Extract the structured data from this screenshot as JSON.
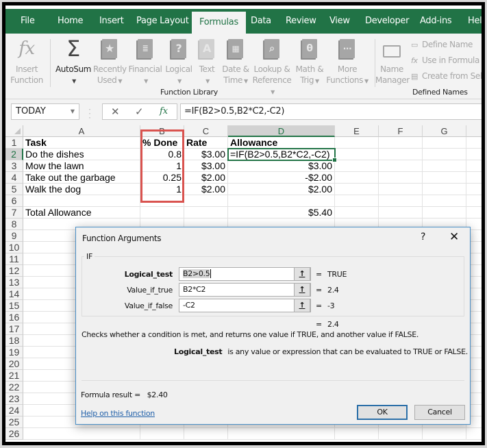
{
  "ribbon": {
    "tabs": [
      {
        "label": "File",
        "active": false
      },
      {
        "label": "Home",
        "active": false
      },
      {
        "label": "Insert",
        "active": false
      },
      {
        "label": "Page Layout",
        "active": false
      },
      {
        "label": "Formulas",
        "active": true
      },
      {
        "label": "Data",
        "active": false
      },
      {
        "label": "Review",
        "active": false
      },
      {
        "label": "View",
        "active": false
      },
      {
        "label": "Developer",
        "active": false
      },
      {
        "label": "Add-ins",
        "active": false
      },
      {
        "label": "Hel",
        "active": false
      }
    ],
    "function_library": {
      "group_label": "Function Library",
      "insert_function": {
        "line1": "Insert",
        "line2": "Function",
        "icon": "fx-icon"
      },
      "autosum": {
        "line1": "AutoSum",
        "icon": "sigma-icon"
      },
      "recently_used": {
        "line1": "Recently",
        "line2": "Used",
        "icon": "star-book-icon"
      },
      "financial": {
        "line1": "Financial",
        "icon": "coins-book-icon"
      },
      "logical": {
        "line1": "Logical",
        "icon": "question-book-icon"
      },
      "text": {
        "line1": "Text",
        "icon": "text-book-icon"
      },
      "date_time": {
        "line1": "Date &",
        "line2": "Time",
        "icon": "calendar-book-icon"
      },
      "lookup_reference": {
        "line1": "Lookup &",
        "line2": "Reference",
        "icon": "magnifier-book-icon"
      },
      "math_trig": {
        "line1": "Math &",
        "line2": "Trig",
        "icon": "theta-book-icon"
      },
      "more_functions": {
        "line1": "More",
        "line2": "Functions",
        "icon": "ellipsis-book-icon"
      }
    },
    "defined_names": {
      "group_label": "Defined Names",
      "name_manager": {
        "line1": "Name",
        "line2": "Manager"
      },
      "define_name": "Define Name",
      "use_in_formula": "Use in Formula",
      "create_from_selection": "Create from Sel"
    }
  },
  "formula_bar": {
    "name_box": "TODAY",
    "cancel_glyph": "✕",
    "enter_glyph": "✓",
    "fx_glyph": "fx",
    "formula": "=IF(B2>0.5,B2*C2,-C2)"
  },
  "sheet": {
    "columns": [
      "A",
      "B",
      "C",
      "D",
      "E",
      "F",
      "G"
    ],
    "selected_column": "D",
    "selected_row": 2,
    "row_numbers": [
      "1",
      "2",
      "3",
      "4",
      "5",
      "6",
      "7",
      "8",
      "9",
      "10",
      "11",
      "12",
      "13",
      "14",
      "15",
      "16",
      "17",
      "18",
      "19",
      "20",
      "21",
      "22",
      "23",
      "24",
      "25",
      "26"
    ],
    "headers": {
      "task": "Task",
      "done": "% Done",
      "rate": "Rate",
      "allowance": "Allowance"
    },
    "rows": [
      {
        "task": "Do the dishes",
        "done": "0.8",
        "rate": "$3.00",
        "allowance": "=IF(B2>0.5,B2*C2,-C2)"
      },
      {
        "task": "Mow the lawn",
        "done": "1",
        "rate": "$3.00",
        "allowance": "$3.00"
      },
      {
        "task": "Take out the garbage",
        "done": "0.25",
        "rate": "$2.00",
        "allowance": "-$2.00"
      },
      {
        "task": "Walk the dog",
        "done": "1",
        "rate": "$2.00",
        "allowance": "$2.00"
      }
    ],
    "total_label": "Total Allowance",
    "total_value": "$5.40",
    "highlight_color": "#d9534f",
    "accent_color": "#217346"
  },
  "dialog": {
    "title": "Function Arguments",
    "help_glyph": "?",
    "close_glyph": "✕",
    "function_name": "IF",
    "arguments": [
      {
        "label": "Logical_test",
        "value": "B2>0.5",
        "result": "TRUE",
        "bold": true
      },
      {
        "label": "Value_if_true",
        "value": "B2*C2",
        "result": "2.4",
        "bold": false
      },
      {
        "label": "Value_if_false",
        "value": "-C2",
        "result": "-3",
        "bold": false
      }
    ],
    "ref_button_glyph": "↑",
    "equals": "=",
    "overall_result": "2.4",
    "description": "Checks whether a condition is met, and returns one value if TRUE, and another value if FALSE.",
    "param_name": "Logical_test",
    "param_description": "is any value or expression that can be evaluated to TRUE or FALSE.",
    "formula_result_label": "Formula result =",
    "formula_result_value": "$2.40",
    "help_link": "Help on this function",
    "ok_label": "OK",
    "cancel_label": "Cancel"
  }
}
